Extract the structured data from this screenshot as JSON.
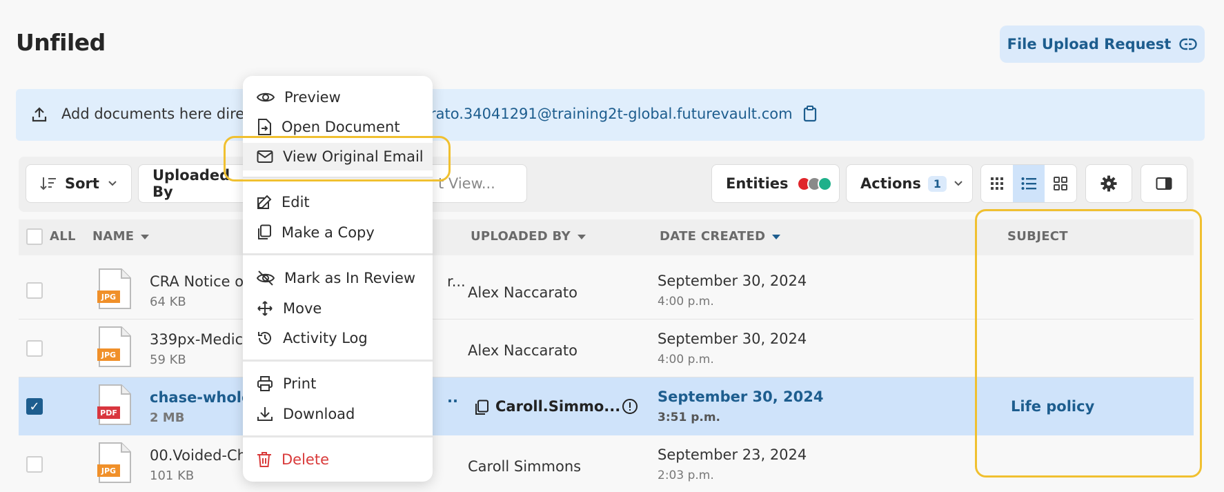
{
  "page": {
    "title": "Unfiled"
  },
  "header": {
    "upload_request_label": "File Upload Request"
  },
  "banner": {
    "text": "Add documents here dire",
    "email": "rato.34041291@training2t-global.futurevault.com"
  },
  "toolbar": {
    "sort_label": "Sort",
    "uploaded_label": "Uploaded By",
    "view_placeholder": "t View...",
    "entities_label": "Entities",
    "entity_colors": [
      "#e0262b",
      "#8a8a8a",
      "#1fb08a"
    ],
    "actions_label": "Actions",
    "actions_count": "1"
  },
  "table": {
    "headers": {
      "all": "ALL",
      "name": "NAME",
      "uploaded_by": "UPLOADED BY",
      "date_created": "DATE CREATED",
      "subject": "SUBJECT"
    },
    "rows": [
      {
        "name": "CRA Notice o",
        "name_trunc": "r...",
        "size": "64 KB",
        "type": "JPG",
        "uploaded_by": "Alex Naccarato",
        "date": "September 30, 2024",
        "time": "4:00 p.m.",
        "subject": "",
        "checked": false
      },
      {
        "name": "339px-Medica",
        "size": "59 KB",
        "type": "JPG",
        "uploaded_by": "Alex Naccarato",
        "date": "September 30, 2024",
        "time": "4:00 p.m.",
        "subject": "",
        "checked": false
      },
      {
        "name": "chase-whole",
        "name_trunc": "..",
        "size": "2 MB",
        "type": "PDF",
        "uploaded_by": "Caroll.Simmo...",
        "date": "September 30, 2024",
        "time": "3:51 p.m.",
        "subject": "Life policy",
        "checked": true
      },
      {
        "name": "00.Voided-Ch",
        "size": "101 KB",
        "type": "JPG",
        "uploaded_by": "Caroll Simmons",
        "date": "September 23, 2024",
        "time": "2:03 p.m.",
        "subject": "",
        "checked": false
      }
    ]
  },
  "context_menu": {
    "items": [
      {
        "label": "Preview",
        "icon": "eye-icon"
      },
      {
        "label": "Open Document",
        "icon": "open-document-icon"
      },
      {
        "label": "View Original Email",
        "icon": "envelope-icon"
      },
      {
        "label": "Edit",
        "icon": "pencil-icon"
      },
      {
        "label": "Make a Copy",
        "icon": "copy-icon"
      },
      {
        "label": "Mark as In Review",
        "icon": "eye-off-icon"
      },
      {
        "label": "Move",
        "icon": "move-icon"
      },
      {
        "label": "Activity Log",
        "icon": "history-icon"
      },
      {
        "label": "Print",
        "icon": "printer-icon"
      },
      {
        "label": "Download",
        "icon": "download-icon"
      },
      {
        "label": "Delete",
        "icon": "trash-icon"
      }
    ]
  },
  "colors": {
    "accent": "#1d5d8e",
    "highlight": "#f0c030",
    "danger": "#d93a3a",
    "selected_row": "#cfe3fa"
  }
}
